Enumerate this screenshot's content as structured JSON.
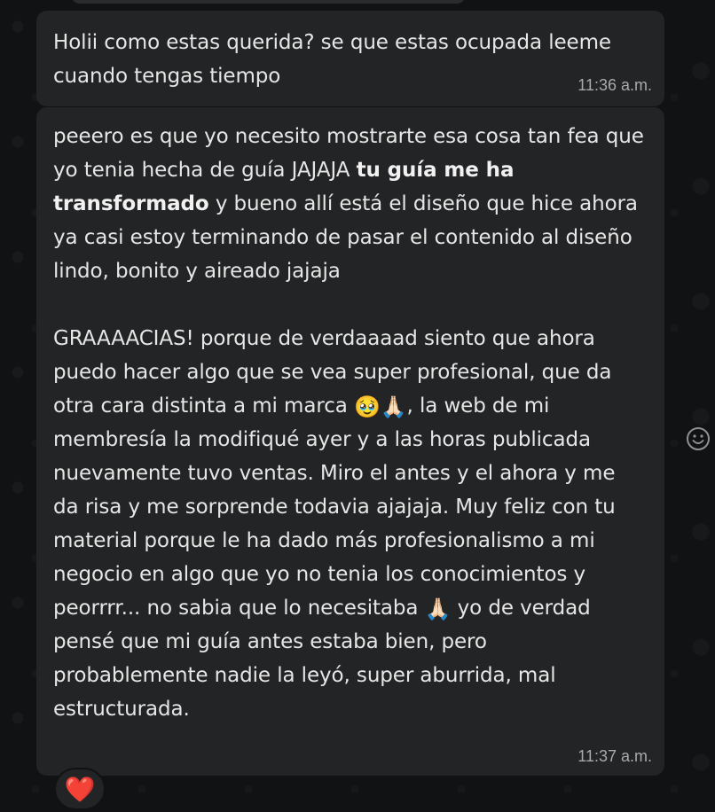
{
  "messages": [
    {
      "text": "Holii como estas querida? se que estas ocupada leeme cuando tengas tiempo",
      "time": "11:36 a.m."
    },
    {
      "p1_a": "peeero es que yo necesito mostrarte esa cosa tan fea que yo tenia hecha de guía JAJAJA ",
      "p1_bold": "tu guía me ha transformado",
      "p1_b": " y bueno allí está el diseño que hice ahora ya casi estoy terminando de pasar el contenido al diseño lindo, bonito y aireado jajaja",
      "p2_a": "GRAAAACIAS! porque de verdaaaad siento que ahora puedo hacer algo que se vea super profesional, que da otra cara distinta a mi marca ",
      "p2_emoji1": "🥹",
      "p2_emoji2": "🙏🏻",
      "p2_b": ", la web de mi membresía la modifiqué ayer y a las horas publicada nuevamente tuvo ventas. Miro el antes y el ahora y me da risa y me sorprende todavia ajajaja. Muy feliz con tu material porque le ha dado más profesionalismo a mi negocio en algo que yo no tenia los conocimientos y peorrrr... no sabia que lo necesitaba ",
      "p2_emoji3": "🙏🏻",
      "p2_c": " yo de verdad pensé que mi guía antes estaba bien, pero probablemente nadie la leyó, super aburrida, mal estructurada.",
      "time": "11:37 a.m."
    }
  ],
  "reaction": {
    "emoji": "❤️",
    "icon": "red-heart"
  },
  "react_button_icon": "smiley-icon",
  "colors": {
    "background": "#111213",
    "bubble": "#232425",
    "text": "#e6e6e6",
    "timestamp": "#a8aaab"
  }
}
